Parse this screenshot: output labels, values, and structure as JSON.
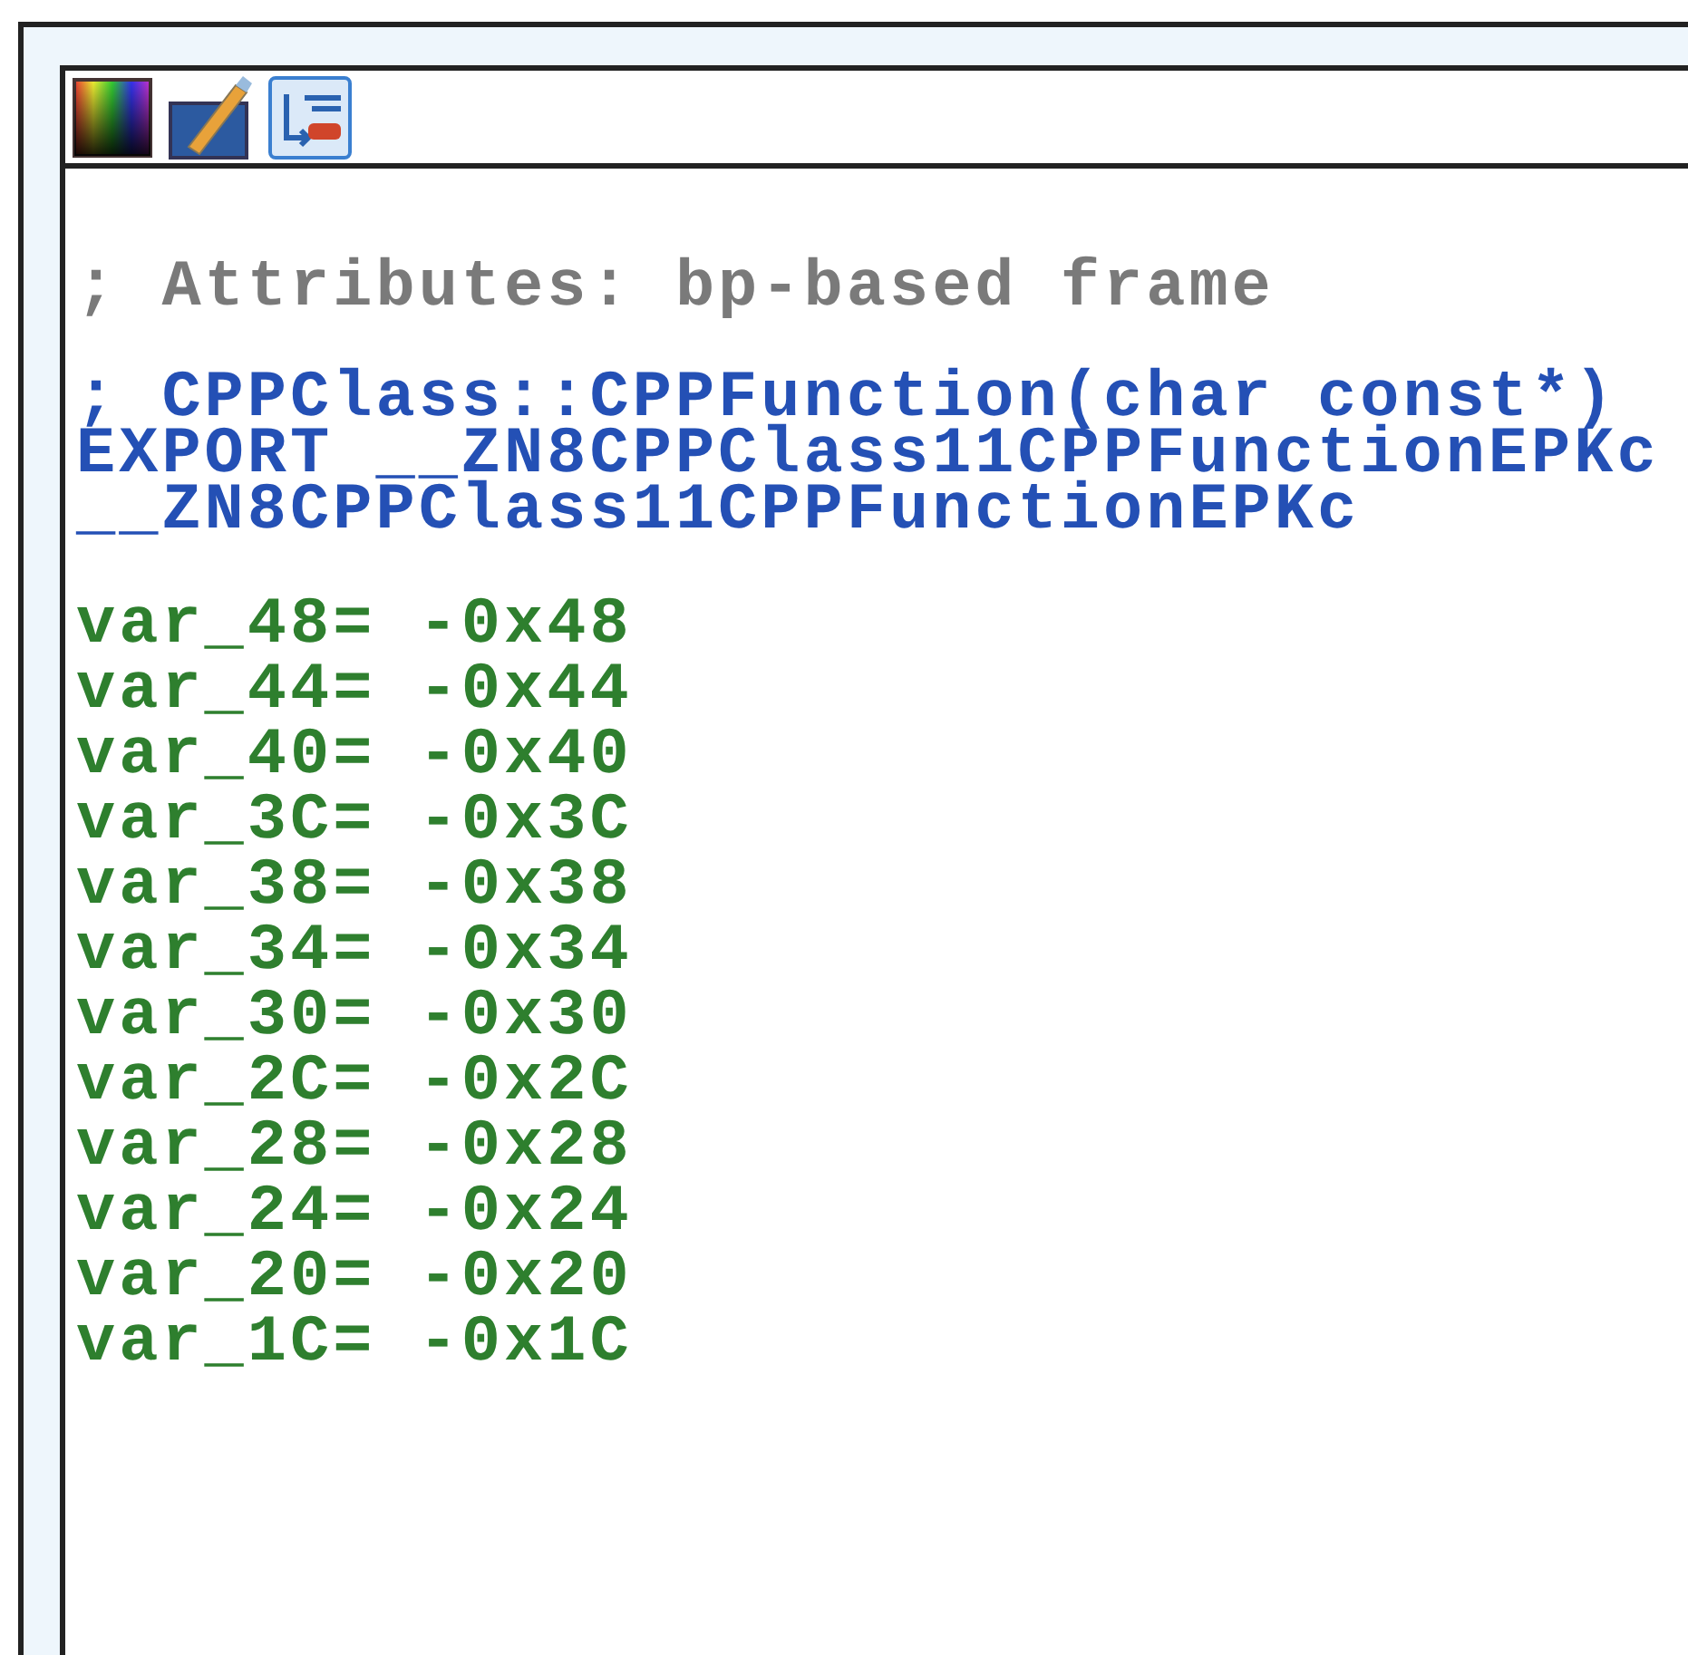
{
  "listing": {
    "blocks": [
      {
        "kind": "comment",
        "lines": [
          "; Attributes: bp-based frame"
        ]
      },
      {
        "kind": "symbol",
        "lines": [
          "; CPPClass::CPPFunction(char const*)",
          "EXPORT __ZN8CPPClass11CPPFunctionEPKc",
          "__ZN8CPPClass11CPPFunctionEPKc"
        ]
      },
      {
        "kind": "variable",
        "lines": [
          "var_48= -0x48",
          "var_44= -0x44",
          "var_40= -0x40",
          "var_3C= -0x3C",
          "var_38= -0x38",
          "var_34= -0x34",
          "var_30= -0x30",
          "var_2C= -0x2C",
          "var_28= -0x28",
          "var_24= -0x24",
          "var_20= -0x20",
          "var_1C= -0x1C"
        ]
      }
    ]
  }
}
